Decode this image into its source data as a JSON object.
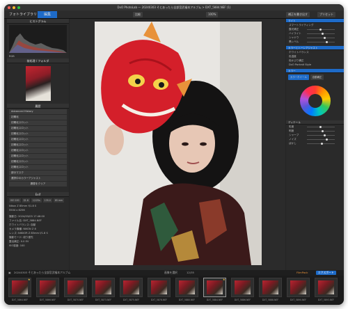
{
  "window": {
    "title": "DxO PhotoLab — 20240303 そとあったら全部宮武福本アルブム > DXT_5884.NEF (1)"
  },
  "tabs": {
    "library": "フォトライブラリ",
    "edit": "編集"
  },
  "toolbar": {
    "compare": "比較",
    "zoom": "100%",
    "export_settings": "補正を書き出す",
    "presets": "プリセット"
  },
  "left_panel": {
    "histogram_title": "ヒストグラム",
    "info_label": "RGB",
    "projects_title": "前処理 / フォルダ",
    "history_title": "履歴",
    "history_header": "Advanced History",
    "history_items": [
      "初期化",
      "初期化スロット",
      "初期化スロット",
      "初期化スロット",
      "初期化スロット",
      "初期化スロット",
      "初期化スロット",
      "初期化スロット",
      "初期化スロット",
      "初期化スロット",
      "部分マスク",
      "選択中のカラーアジャスト"
    ],
    "history_clear": "履歴をクリア",
    "exif_title": "Exif",
    "exif_values": [
      "ISO 100",
      "f/1.8",
      "1/125s",
      "135.0",
      "85 mm"
    ],
    "exif_lens": "Nikon Z 85mm f/1.8 S",
    "exif_size": "5504 x 8256",
    "meta_rows": [
      "撮影日: 2024/03/03 17:46:00",
      "ファイル名: DXT_5884.NEF",
      "ホワイトバランス: 自動",
      "カメラ機種: NIKON Z 8",
      "レンズ: NIKKOR Z 85mm f/1.8 S",
      "撮影モード: 絞り優先",
      "露出補正: 0.0 EV",
      "ISO感度: 100"
    ]
  },
  "right_panel": {
    "section1": "ライト",
    "auto_label": "スマートライティング",
    "sliders1": [
      "露光補正",
      "ハイライト",
      "シャドウ",
      "黒レベル"
    ],
    "section2": "カラーとトーンアジャスト",
    "rows2": [
      "ホワイトバランス",
      "色温度",
      "色かぶり補正"
    ],
    "profile_label": "DxO Portrait Style",
    "section3": "カラー",
    "color_btn1": "カラーホイール",
    "color_btn2": "自動補正",
    "section4": "ディテール",
    "sliders4": [
      "彩度",
      "明度",
      "シャープ",
      "ノイズ",
      "ぼかし"
    ],
    "export_label": "エクスポート",
    "filmpack_label": "FilmPack"
  },
  "path_bar": {
    "path": "20240303 そとあったら全部宮武福本アルブム",
    "mode": "画像を選択",
    "count": "12/35"
  },
  "filmstrip": [
    {
      "name": "DXT_5864.NEF",
      "rating": "★"
    },
    {
      "name": "DXT_5866.NEF",
      "rating": ""
    },
    {
      "name": "DXT_5870.NEF",
      "rating": ""
    },
    {
      "name": "DXT_5873.NEF",
      "rating": ""
    },
    {
      "name": "DXT_5875.NEF",
      "rating": ""
    },
    {
      "name": "DXT_5878.NEF",
      "rating": ""
    },
    {
      "name": "DXT_5880.NEF",
      "rating": ""
    },
    {
      "name": "DXT_5884.NEF",
      "rating": "★"
    },
    {
      "name": "DXT_5886.NEF",
      "rating": ""
    },
    {
      "name": "DXT_5888.NEF",
      "rating": ""
    },
    {
      "name": "DXT_5890.NEF",
      "rating": ""
    },
    {
      "name": "DXT_5893.NEF",
      "rating": ""
    }
  ],
  "colors": {
    "accent": "#1e6bc8",
    "panel": "#2a2a2a",
    "mask": "#d4202a"
  }
}
